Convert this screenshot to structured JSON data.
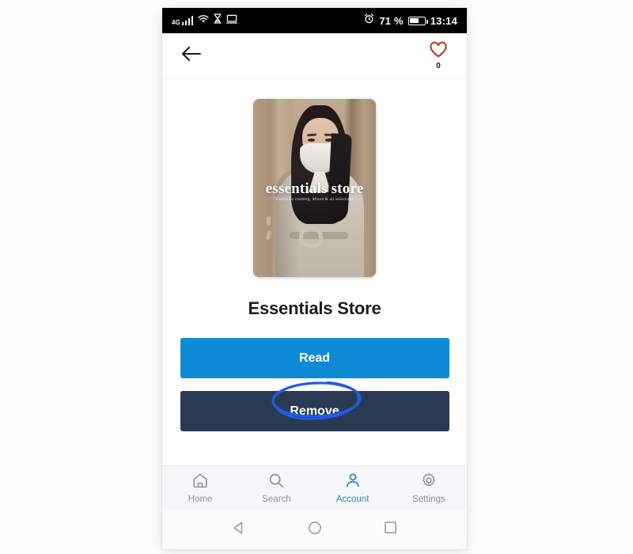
{
  "status_bar": {
    "network_label": "4G",
    "icons": [
      "signal-bars-icon",
      "wifi-icon",
      "hourglass-icon",
      "cast-screen-icon",
      "alarm-icon",
      "battery-icon"
    ],
    "battery_percent": "71 %",
    "clock": "13:14",
    "background_color": "#000000"
  },
  "header": {
    "back_icon": "back-arrow-icon",
    "favorite_icon": "heart-outline-icon",
    "favorite_color": "#c0392b",
    "favorite_count": "0"
  },
  "book": {
    "cover_title": "essentials store",
    "cover_subtitle": "Essentials clothing, Mixed & all selections",
    "title": "Essentials Store"
  },
  "actions": {
    "read_label": "Read",
    "read_color": "#0d8ad4",
    "remove_label": "Remove",
    "remove_color": "#2b3a53",
    "annotation": {
      "shape": "ellipse",
      "target": "Remove",
      "color": "#1f5ce8"
    }
  },
  "tabbar": {
    "active_color": "#1b8fc4",
    "inactive_color": "#8e9299",
    "items": [
      {
        "label": "Home",
        "icon": "home-icon",
        "active": false
      },
      {
        "label": "Search",
        "icon": "search-icon",
        "active": false
      },
      {
        "label": "Account",
        "icon": "person-icon",
        "active": true
      },
      {
        "label": "Settings",
        "icon": "gear-icon",
        "active": false
      }
    ]
  },
  "system_nav": {
    "back": "triangle-back-icon",
    "home": "circle-home-icon",
    "recents": "square-recents-icon"
  }
}
